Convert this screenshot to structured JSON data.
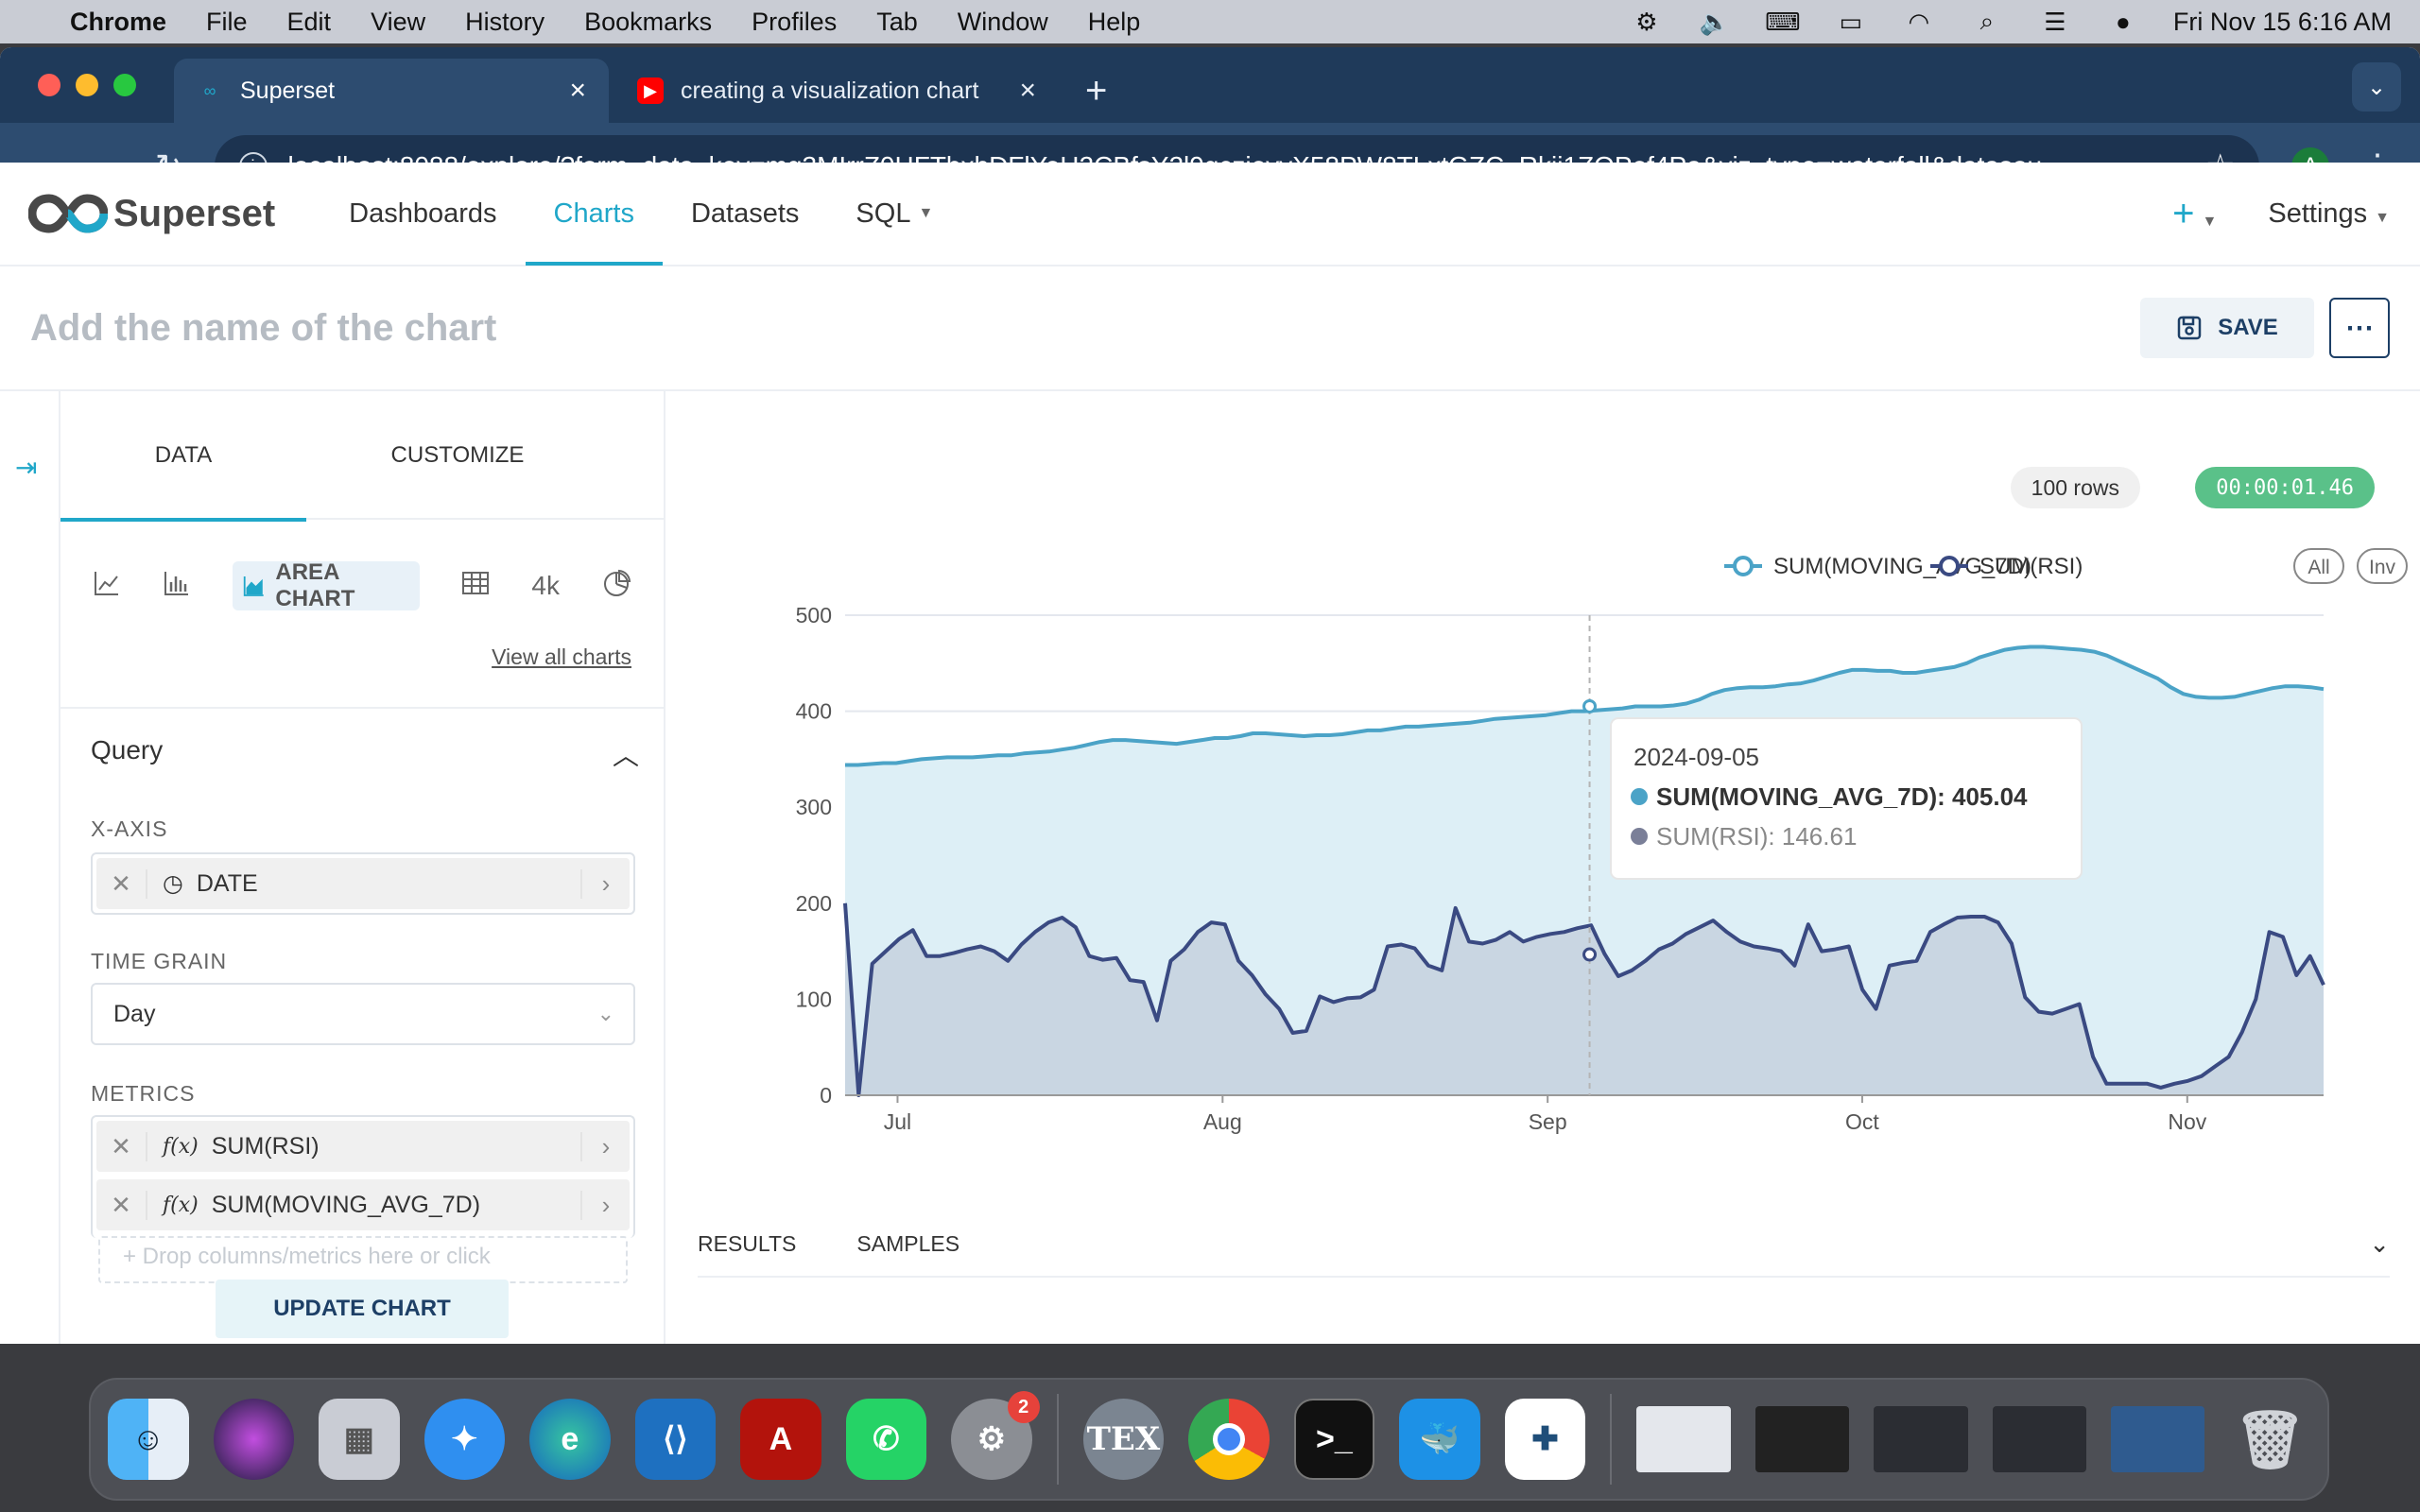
{
  "menubar": {
    "app": "Chrome",
    "items": [
      "File",
      "Edit",
      "View",
      "History",
      "Bookmarks",
      "Profiles",
      "Tab",
      "Window",
      "Help"
    ],
    "datetime": "Fri Nov 15  6:16 AM"
  },
  "browser": {
    "tabs": [
      {
        "title": "Superset",
        "active": true
      },
      {
        "title": "creating a visualization chart",
        "active": false
      }
    ],
    "url": "localhost:8088/explore/?form_data_key=mg3MIrrZ0HFTbxhDFlYeH2CBfsY2l9qczjeyvX58PW8TLxtGZC_Rkij1ZQPef4Pa&viz_type=waterfall&datasou...",
    "profile_initial": "A"
  },
  "superset": {
    "brand": "Superset",
    "nav": [
      "Dashboards",
      "Charts",
      "Datasets",
      "SQL"
    ],
    "active_nav": "Charts",
    "settings_label": "Settings",
    "chart_name_placeholder": "Add the name of the chart",
    "save_label": "SAVE",
    "more_label": "⋯"
  },
  "left_panel": {
    "tabs": [
      "DATA",
      "CUSTOMIZE"
    ],
    "viz_active_label": "AREA CHART",
    "viz_4k_label": "4k",
    "view_all": "View all charts",
    "query_title": "Query",
    "x_axis_label": "X-AXIS",
    "x_axis_value": "DATE",
    "time_grain_label": "TIME GRAIN",
    "time_grain_value": "Day",
    "metrics_label": "METRICS",
    "metrics": [
      "SUM(RSI)",
      "SUM(MOVING_AVG_7D)"
    ],
    "drop_placeholder": "+ Drop columns/metrics here or click",
    "update_button": "UPDATE CHART"
  },
  "chart_panel": {
    "rows": "100 rows",
    "timer": "00:00:01.46",
    "legend_all": "All",
    "legend_inv": "Inv",
    "bottom_tabs": [
      "RESULTS",
      "SAMPLES"
    ]
  },
  "tooltip": {
    "date": "2024-09-05",
    "line1": "SUM(MOVING_AVG_7D): 405.04",
    "line2": "SUM(RSI): 146.61"
  },
  "chart_data": {
    "type": "area",
    "title": "",
    "xlabel": "",
    "ylabel": "",
    "ylim": [
      0,
      500
    ],
    "yticks": [
      0,
      100,
      200,
      300,
      400,
      500
    ],
    "xticks": [
      {
        "label": "Jul",
        "date": "2024-07-01"
      },
      {
        "label": "Aug",
        "date": "2024-08-01"
      },
      {
        "label": "Sep",
        "date": "2024-09-01"
      },
      {
        "label": "Oct",
        "date": "2024-10-01"
      },
      {
        "label": "Nov",
        "date": "2024-11-01"
      }
    ],
    "x_start": "2024-06-26",
    "x_end": "2024-11-14",
    "grid": true,
    "legend_position": "top-right",
    "series": [
      {
        "name": "SUM(MOVING_AVG_7D)",
        "color": "#4ba3c7",
        "values": [
          344,
          344,
          345,
          346,
          346,
          348,
          350,
          351,
          352,
          352,
          352,
          353,
          354,
          354,
          356,
          357,
          358,
          360,
          362,
          365,
          368,
          370,
          370,
          369,
          368,
          367,
          366,
          368,
          370,
          372,
          372,
          374,
          377,
          377,
          376,
          375,
          374,
          375,
          375,
          376,
          378,
          380,
          380,
          382,
          384,
          384,
          385,
          386,
          387,
          388,
          390,
          392,
          393,
          394,
          395,
          396,
          398,
          400,
          400,
          401,
          402,
          403,
          405,
          405,
          405,
          406,
          408,
          412,
          418,
          422,
          424,
          425,
          425,
          426,
          428,
          429,
          432,
          436,
          440,
          443,
          443,
          442,
          442,
          440,
          440,
          442,
          444,
          446,
          450,
          456,
          460,
          464,
          466,
          467,
          467,
          466,
          465,
          464,
          462,
          458,
          452,
          446,
          440,
          434,
          425,
          418,
          415,
          414,
          414,
          415,
          418,
          421,
          424,
          426,
          426,
          425,
          423
        ],
        "tooltip_value": 405.04
      },
      {
        "name": "SUM(RSI)",
        "color": "#3a4a82",
        "values": [
          200,
          0,
          137,
          150,
          163,
          172,
          145,
          145,
          148,
          152,
          155,
          150,
          140,
          157,
          170,
          180,
          185,
          175,
          145,
          141,
          143,
          120,
          118,
          78,
          140,
          152,
          170,
          180,
          178,
          140,
          125,
          105,
          90,
          65,
          67,
          103,
          97,
          101,
          102,
          110,
          155,
          157,
          153,
          135,
          130,
          195,
          160,
          158,
          162,
          170,
          160,
          165,
          168,
          170,
          174,
          177,
          147,
          124,
          130,
          140,
          152,
          158,
          168,
          175,
          182,
          170,
          160,
          155,
          153,
          150,
          135,
          178,
          150,
          152,
          155,
          110,
          90,
          135,
          138,
          140,
          170,
          178,
          185,
          186,
          186,
          180,
          158,
          102,
          87,
          85,
          90,
          95,
          40,
          12,
          12,
          12,
          12,
          8,
          12,
          15,
          20,
          30,
          40,
          66,
          100,
          170,
          165,
          125,
          145,
          115
        ],
        "tooltip_value": 146.61
      }
    ]
  },
  "dock": {
    "apps": [
      "Finder",
      "Siri",
      "Launchpad",
      "Safari",
      "Edge",
      "VS Code",
      "Acrobat",
      "WhatsApp",
      "System Settings",
      "TeX",
      "Chrome",
      "Terminal",
      "Docker",
      "Tableau"
    ],
    "settings_badge": "2"
  }
}
